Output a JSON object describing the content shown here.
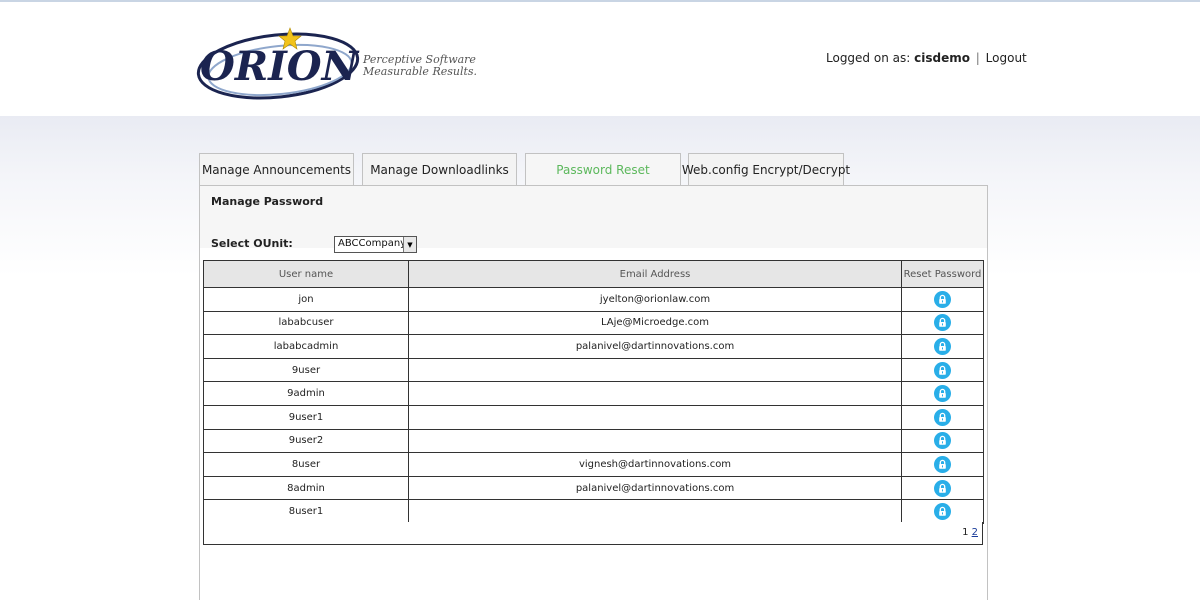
{
  "header": {
    "logo_text": "ORION",
    "tagline_1": "Perceptive Software.",
    "tagline_2": "Measurable Results.",
    "logged_prefix": "Logged on as:",
    "username": "cisdemo",
    "separator": "|",
    "logout": "Logout"
  },
  "tabs": [
    {
      "label": "Manage Announcements"
    },
    {
      "label": "Manage Downloadlinks"
    },
    {
      "label": "Password Reset"
    },
    {
      "label": "Web.config Encrypt/Decrypt"
    }
  ],
  "panel": {
    "title": "Manage Password",
    "ounit_label": "Select OUnit:",
    "ounit_value": "ABCCompany"
  },
  "table": {
    "columns": [
      "User name",
      "Email Address",
      "Reset Password"
    ],
    "rows": [
      {
        "user": "jon",
        "email": "jyelton@orionlaw.com"
      },
      {
        "user": "lababcuser",
        "email": "LAje@Microedge.com"
      },
      {
        "user": "lababcadmin",
        "email": "palanivel@dartinnovations.com"
      },
      {
        "user": "9user",
        "email": ""
      },
      {
        "user": "9admin",
        "email": ""
      },
      {
        "user": "9user1",
        "email": ""
      },
      {
        "user": "9user2",
        "email": ""
      },
      {
        "user": "8user",
        "email": "vignesh@dartinnovations.com"
      },
      {
        "user": "8admin",
        "email": "palanivel@dartinnovations.com"
      },
      {
        "user": "8user1",
        "email": ""
      }
    ]
  },
  "pager": {
    "current": "1",
    "next": "2"
  },
  "colors": {
    "active_tab": "#5cb85c",
    "lock_button": "#29aee8",
    "logo_navy": "#1b2450",
    "star": "#f2c31c"
  },
  "icons": {
    "reset": "lock-icon",
    "logo_star": "star-icon"
  }
}
